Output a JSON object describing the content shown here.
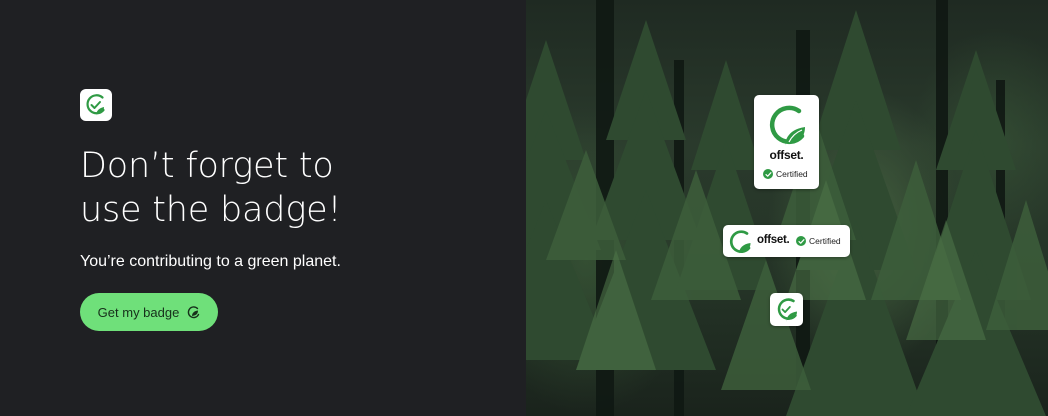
{
  "promo": {
    "headline_line1": "Don’t forget to",
    "headline_line2": "use the badge!",
    "subtitle": "You’re contributing to a green planet.",
    "cta_label": "Get my badge",
    "app_icon": "offset-leaf-check-icon",
    "cta_icon": "leaf-circle-icon"
  },
  "badges": {
    "vertical": {
      "wordmark": "offset.",
      "certified_label": "Certified"
    },
    "horizontal": {
      "wordmark": "offset.",
      "certified_label": "Certified"
    },
    "small": {
      "icon": "offset-leaf-icon"
    }
  },
  "colors": {
    "left_panel_bg": "#1f2023",
    "cta_bg": "#6fe07a",
    "brand_green": "#2f9a44",
    "text_primary": "#ffffff"
  },
  "background_image": "pine-forest-photo"
}
